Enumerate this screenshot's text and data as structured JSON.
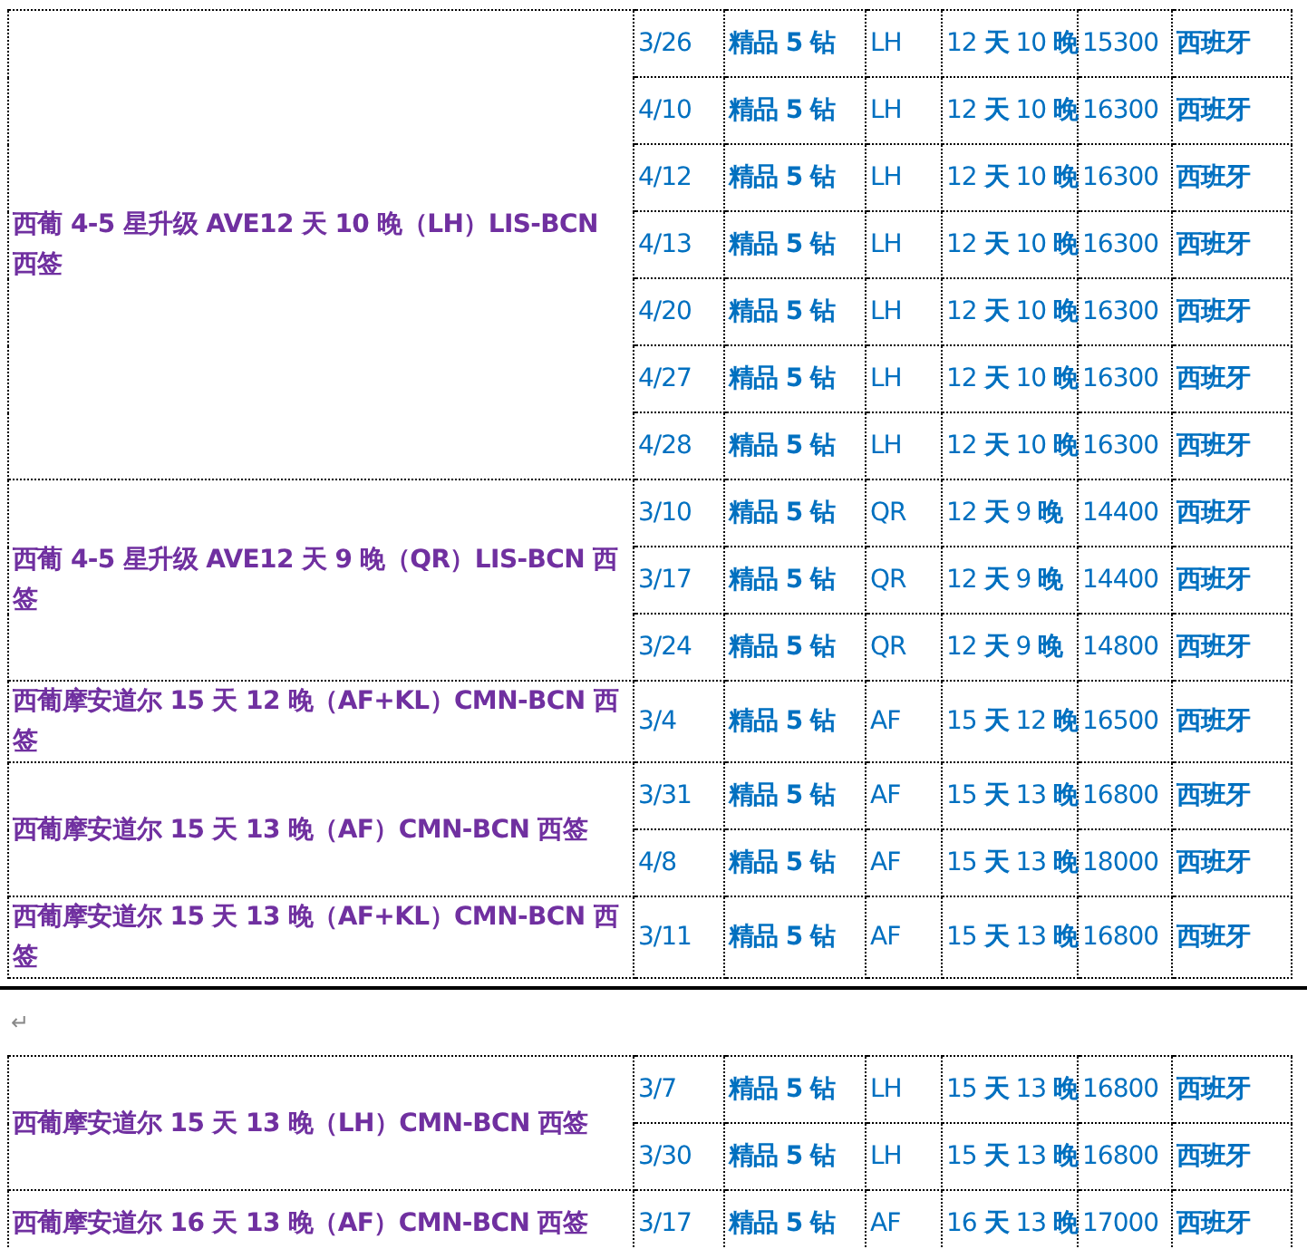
{
  "tables": [
    {
      "groups": [
        {
          "title": "西葡 4-5 星升级 AVE12 天 10 晚（LH）LIS-BCN 西签",
          "rows": [
            {
              "date": "3/26",
              "grade": "精品 5 钻",
              "airline": "LH",
              "duration": "12 **天** 10 **晚**",
              "price": "15300",
              "country": "西班牙"
            },
            {
              "date": "4/10",
              "grade": "精品 5 钻",
              "airline": "LH",
              "duration": "12 **天** 10 **晚**",
              "price": "16300",
              "country": "西班牙"
            },
            {
              "date": "4/12",
              "grade": "精品 5 钻",
              "airline": "LH",
              "duration": "12 **天** 10 **晚**",
              "price": "16300",
              "country": "西班牙"
            },
            {
              "date": "4/13",
              "grade": "精品 5 钻",
              "airline": "LH",
              "duration": "12 **天** 10 **晚**",
              "price": "16300",
              "country": "西班牙"
            },
            {
              "date": "4/20",
              "grade": "精品 5 钻",
              "airline": "LH",
              "duration": "12 **天** 10 **晚**",
              "price": "16300",
              "country": "西班牙"
            },
            {
              "date": "4/27",
              "grade": "精品 5 钻",
              "airline": "LH",
              "duration": "12 **天** 10 **晚**",
              "price": "16300",
              "country": "西班牙"
            },
            {
              "date": "4/28",
              "grade": "精品 5 钻",
              "airline": "LH",
              "duration": "12 **天** 10 **晚**",
              "price": "16300",
              "country": "西班牙"
            }
          ]
        },
        {
          "title": "西葡 4-5 星升级 AVE12 天 9 晚（QR）LIS-BCN 西签",
          "rows": [
            {
              "date": "3/10",
              "grade": "精品 5 钻",
              "airline": "QR",
              "duration": "12 **天** 9 **晚**",
              "price": "14400",
              "country": "西班牙"
            },
            {
              "date": "3/17",
              "grade": "精品 5 钻",
              "airline": "QR",
              "duration": "12 **天** 9 **晚**",
              "price": "14400",
              "country": "西班牙"
            },
            {
              "date": "3/24",
              "grade": "精品 5 钻",
              "airline": "QR",
              "duration": "12 **天** 9 **晚**",
              "price": "14800",
              "country": "西班牙"
            }
          ]
        },
        {
          "title": "西葡摩安道尔 15 天 12 晚（AF+KL）CMN-BCN 西签",
          "rows": [
            {
              "date": "3/4",
              "grade": "精品 5 钻",
              "airline": "AF",
              "duration": "15 **天** 12 **晚**",
              "price": "16500",
              "country": "西班牙"
            }
          ]
        },
        {
          "title": "西葡摩安道尔 15 天 13 晚（AF）CMN-BCN 西签",
          "rows": [
            {
              "date": "3/31",
              "grade": "精品 5 钻",
              "airline": "AF",
              "duration": "15 **天** 13 **晚**",
              "price": "16800",
              "country": "西班牙"
            },
            {
              "date": "4/8",
              "grade": "精品 5 钻",
              "airline": "AF",
              "duration": "15 **天** 13 **晚**",
              "price": "18000",
              "country": "西班牙"
            }
          ]
        },
        {
          "title": "西葡摩安道尔 15 天 13 晚（AF+KL）CMN-BCN 西签",
          "rows": [
            {
              "date": "3/11",
              "grade": "精品 5 钻",
              "airline": "AF",
              "duration": "15 **天** 13 **晚**",
              "price": "16800",
              "country": "西班牙"
            }
          ]
        }
      ]
    },
    {
      "groups": [
        {
          "title": "西葡摩安道尔 15 天 13 晚（LH）CMN-BCN 西签",
          "rows": [
            {
              "date": "3/7",
              "grade": "精品 5 钻",
              "airline": "LH",
              "duration": "15 **天** 13 **晚**",
              "price": "16800",
              "country": "西班牙"
            },
            {
              "date": "3/30",
              "grade": "精品 5 钻",
              "airline": "LH",
              "duration": "15 **天** 13 **晚**",
              "price": "16800",
              "country": "西班牙"
            }
          ]
        },
        {
          "title": "西葡摩安道尔 16 天 13 晚（AF）CMN-BCN 西签",
          "rows": [
            {
              "date": "3/17",
              "grade": "精品 5 钻",
              "airline": "AF",
              "duration": "16 **天** 13 **晚**",
              "price": "17000",
              "country": "西班牙"
            }
          ]
        }
      ]
    }
  ],
  "paragraph_mark": "↵"
}
